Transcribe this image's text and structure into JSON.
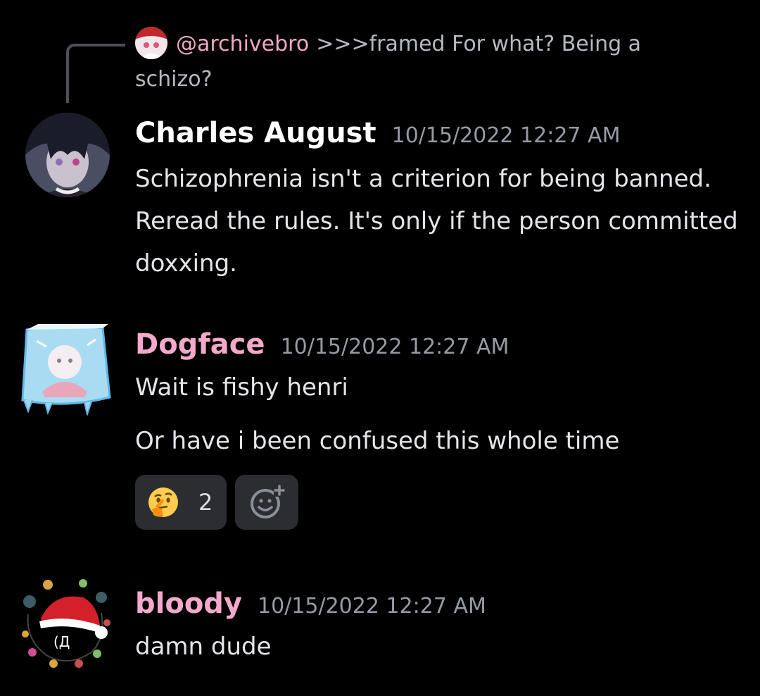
{
  "reply": {
    "username": "@archivebro",
    "text": ">>>framed  For what? Being a schizo?"
  },
  "messages": [
    {
      "username": "Charles August",
      "timestamp": "10/15/2022 12:27 AM",
      "lines": [
        "Schizophrenia isn't a criterion for being banned. Reread the rules. It's only if the person committed doxxing."
      ]
    },
    {
      "username": "Dogface",
      "timestamp": "10/15/2022 12:27 AM",
      "lines": [
        "Wait is fishy henri",
        "Or have i been confused this whole time"
      ],
      "reactions": [
        {
          "emoji": "thinking-face-icon",
          "count": "2"
        }
      ]
    },
    {
      "username": "bloody",
      "timestamp": "10/15/2022 12:27 AM",
      "lines": [
        "damn dude"
      ]
    }
  ],
  "colors": {
    "background": "#000000",
    "username_default": "#ffffff",
    "username_pink": "#f4a9cc",
    "timestamp": "#949ba4",
    "reaction_bg": "#2b2d31"
  }
}
